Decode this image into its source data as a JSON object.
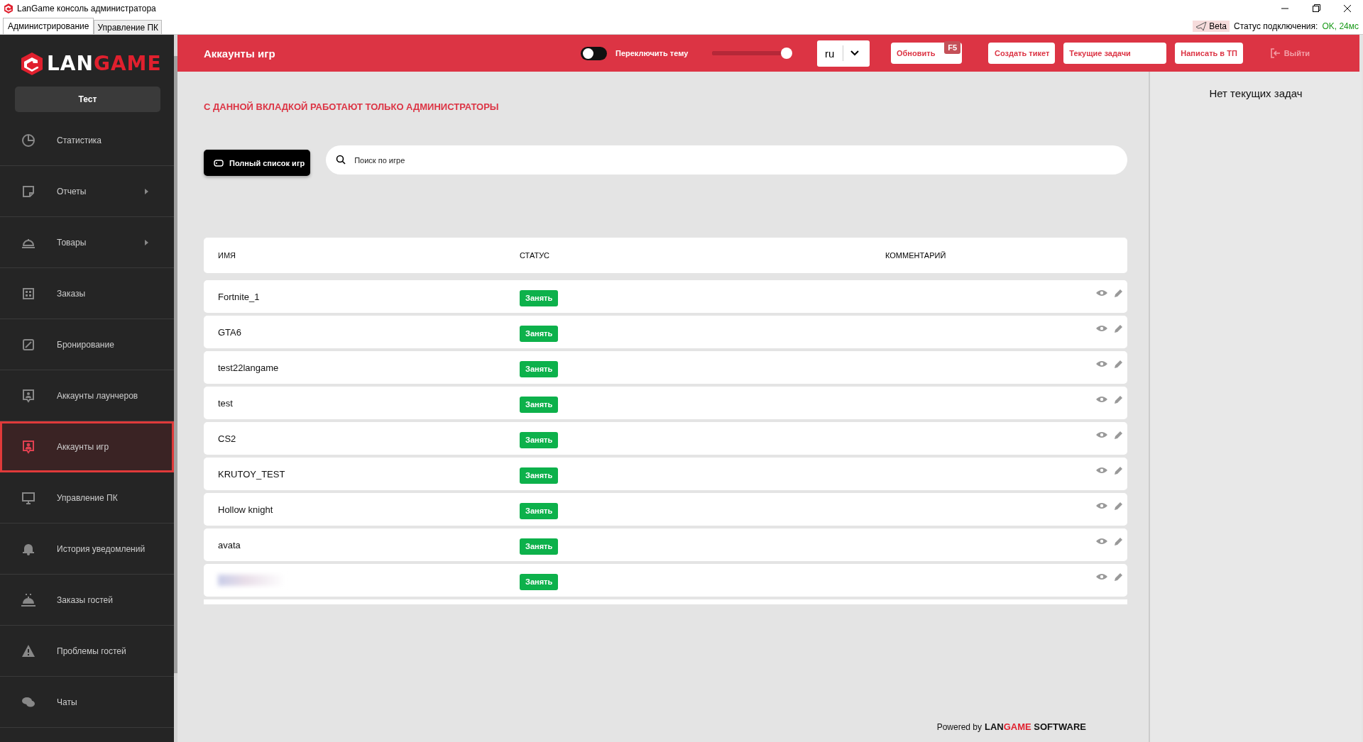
{
  "window": {
    "title": "LanGame консоль администратора"
  },
  "app_tabs": [
    {
      "label": "Администрирование",
      "selected": true
    },
    {
      "label": "Управление ПК",
      "selected": false
    }
  ],
  "connection": {
    "badge": "Beta",
    "label": "Статус подключения:",
    "value": "OK, 24мс"
  },
  "sidebar": {
    "logo": {
      "part_1": "LAN",
      "part_2": "GAME"
    },
    "club": "Тест",
    "items": [
      {
        "label": "Статистика",
        "has_submenu": false,
        "selected": false
      },
      {
        "label": "Отчеты",
        "has_submenu": true,
        "selected": false
      },
      {
        "label": "Товары",
        "has_submenu": true,
        "selected": false
      },
      {
        "label": "Заказы",
        "has_submenu": false,
        "selected": false
      },
      {
        "label": "Бронирование",
        "has_submenu": false,
        "selected": false
      },
      {
        "label": "Аккаунты лаунчеров",
        "has_submenu": false,
        "selected": false
      },
      {
        "label": "Аккаунты игр",
        "has_submenu": false,
        "selected": true
      },
      {
        "label": "Управление ПК",
        "has_submenu": false,
        "selected": false
      },
      {
        "label": "История уведомлений",
        "has_submenu": false,
        "selected": false
      },
      {
        "label": "Заказы гостей",
        "has_submenu": false,
        "selected": false
      },
      {
        "label": "Проблемы гостей",
        "has_submenu": false,
        "selected": false
      },
      {
        "label": "Чаты",
        "has_submenu": false,
        "selected": false
      }
    ]
  },
  "header": {
    "title": "Аккаунты игр",
    "theme_switch": {
      "label": "Переключить тему",
      "on": false
    },
    "slider": {
      "level": 0.95
    },
    "language": "ru",
    "buttons": [
      {
        "label": "Обновить",
        "hotkey": "F5"
      },
      {
        "label": "Создать тикет"
      },
      {
        "label": "Текущие задачи"
      },
      {
        "label": "Написать в ТП"
      }
    ],
    "logout": "Выйти"
  },
  "notice": "С ДАННОЙ ВКЛАДКОЙ РАБОТАЮТ ТОЛЬКО АДМИНИСТРАТОРЫ",
  "full_list_button": "Полный список игр",
  "search": {
    "placeholder": "Поиск по игре"
  },
  "table": {
    "columns": [
      "ИМЯ",
      "СТАТУС",
      "КОММЕНТАРИЙ"
    ],
    "rows": [
      {
        "name": "Fortnite_1",
        "status": "Занять",
        "redacted": false
      },
      {
        "name": "GTA6",
        "status": "Занять",
        "redacted": false
      },
      {
        "name": "test22langame",
        "status": "Занять",
        "redacted": false
      },
      {
        "name": "test",
        "status": "Занять",
        "redacted": false
      },
      {
        "name": "CS2",
        "status": "Занять",
        "redacted": false
      },
      {
        "name": "KRUTOY_TEST",
        "status": "Занять",
        "redacted": false
      },
      {
        "name": "Hollow knight",
        "status": "Занять",
        "redacted": false
      },
      {
        "name": "avata",
        "status": "Занять",
        "redacted": false
      },
      {
        "status": "Занять",
        "redacted": true
      }
    ]
  },
  "tasks_panel": {
    "empty_text": "Нет текущих задач"
  },
  "footer": {
    "prefix": "Powered by",
    "brand_1": "LAN",
    "brand_2": "GAME",
    "brand_3": "SOFTWARE"
  }
}
